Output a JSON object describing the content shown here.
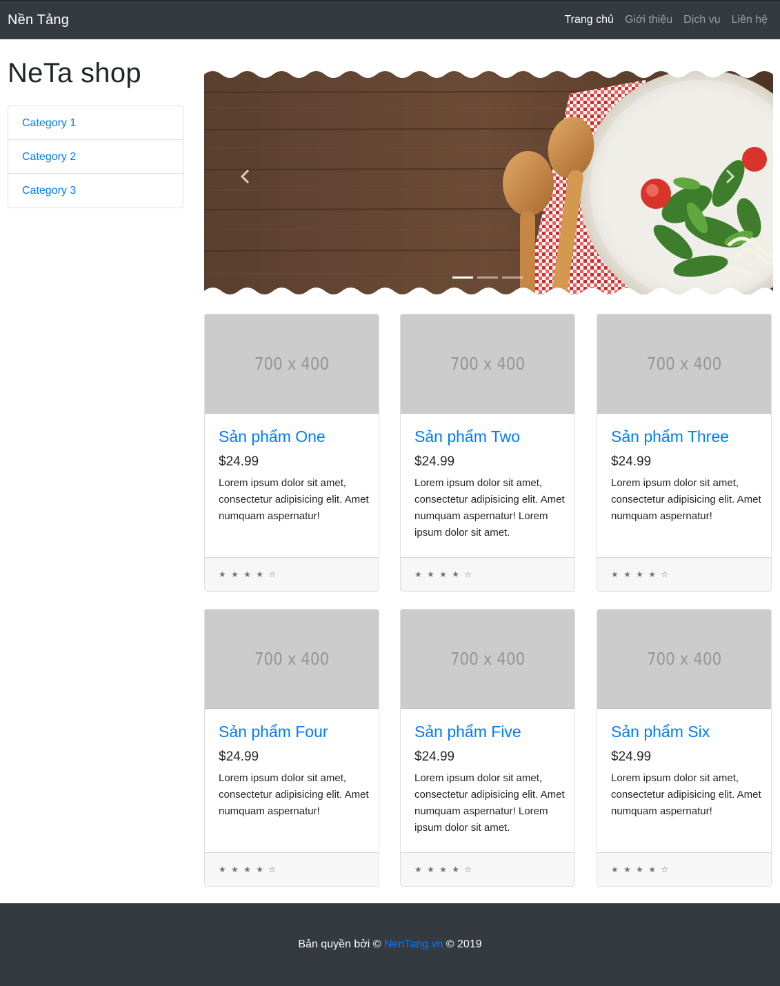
{
  "navbar": {
    "brand": "Nền Tảng",
    "links": [
      "Trang chủ",
      "Giới thiệu",
      "Dịch vụ",
      "Liên hệ"
    ]
  },
  "sidebar": {
    "title": "NeTa shop",
    "categories": [
      "Category 1",
      "Category 2",
      "Category 3"
    ]
  },
  "carousel": {
    "slide_count": 3,
    "active_index": 0
  },
  "products": [
    {
      "title": "Sản phẩm One",
      "price": "$24.99",
      "image_text": "700 x 400",
      "description": "Lorem ipsum dolor sit amet, consectetur adipisicing elit. Amet numquam aspernatur!",
      "rating": "★ ★ ★ ★ ☆"
    },
    {
      "title": "Sản phẩm Two",
      "price": "$24.99",
      "image_text": "700 x 400",
      "description": "Lorem ipsum dolor sit amet, consectetur adipisicing elit. Amet numquam aspernatur! Lorem ipsum dolor sit amet.",
      "rating": "★ ★ ★ ★ ☆"
    },
    {
      "title": "Sản phẩm Three",
      "price": "$24.99",
      "image_text": "700 x 400",
      "description": "Lorem ipsum dolor sit amet, consectetur adipisicing elit. Amet numquam aspernatur!",
      "rating": "★ ★ ★ ★ ☆"
    },
    {
      "title": "Sản phẩm Four",
      "price": "$24.99",
      "image_text": "700 x 400",
      "description": "Lorem ipsum dolor sit amet, consectetur adipisicing elit. Amet numquam aspernatur!",
      "rating": "★ ★ ★ ★ ☆"
    },
    {
      "title": "Sản phẩm Five",
      "price": "$24.99",
      "image_text": "700 x 400",
      "description": "Lorem ipsum dolor sit amet, consectetur adipisicing elit. Amet numquam aspernatur! Lorem ipsum dolor sit amet.",
      "rating": "★ ★ ★ ★ ☆"
    },
    {
      "title": "Sản phẩm Six",
      "price": "$24.99",
      "image_text": "700 x 400",
      "description": "Lorem ipsum dolor sit amet, consectetur adipisicing elit. Amet numquam aspernatur!",
      "rating": "★ ★ ★ ★ ☆"
    }
  ],
  "footer": {
    "prefix": "Bản quyền bởi © ",
    "link_text": "NenTang.vn",
    "suffix": " © 2019"
  },
  "colors": {
    "navbar_bg": "#343a40",
    "link": "#007bff",
    "footer_bg": "#343a40"
  }
}
